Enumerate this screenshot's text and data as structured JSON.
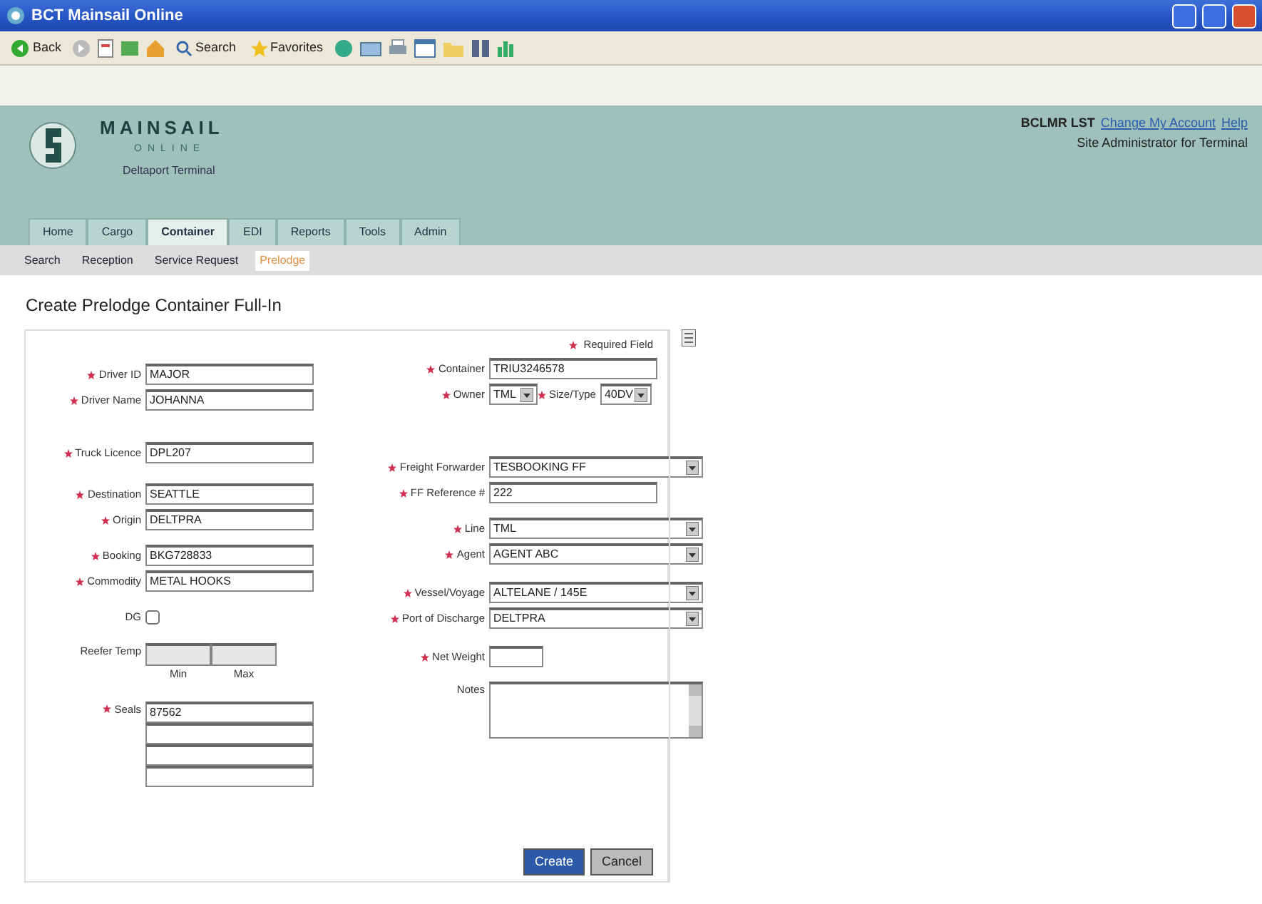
{
  "window": {
    "title": "BCT Mainsail Online"
  },
  "toolbar": {
    "back": "Back",
    "search": "Search",
    "favorites": "Favorites"
  },
  "header": {
    "logo_title": "MAINSAIL",
    "logo_subtitle": "ONLINE",
    "terminal": "Deltaport Terminal",
    "user": "BCLMR LST",
    "links": [
      "Change My Account",
      "Help"
    ],
    "role": "Site Administrator for Terminal"
  },
  "tabs": [
    {
      "label": "Home",
      "selected": false
    },
    {
      "label": "Cargo",
      "selected": false
    },
    {
      "label": "Container",
      "selected": true
    },
    {
      "label": "EDI",
      "selected": false
    },
    {
      "label": "Reports",
      "selected": false
    },
    {
      "label": "Tools",
      "selected": false
    },
    {
      "label": "Admin",
      "selected": false
    }
  ],
  "subtabs": [
    {
      "label": "Search",
      "selected": false
    },
    {
      "label": "Reception",
      "selected": false
    },
    {
      "label": "Service Request",
      "selected": false
    },
    {
      "label": "Prelodge",
      "selected": true
    }
  ],
  "heading": "Create Prelodge Container Full-In",
  "required_note": "Required Field",
  "left_groups": [
    {
      "fields": [
        {
          "kind": "text",
          "label": "Driver ID",
          "required": true,
          "value": "MAJOR"
        },
        {
          "kind": "text",
          "label": "Driver Name",
          "required": true,
          "value": "JOHANNA"
        }
      ]
    },
    {
      "fields": [
        {
          "kind": "text",
          "label": "Truck Licence",
          "required": true,
          "value": "DPL207"
        }
      ]
    },
    {
      "fields": [
        {
          "kind": "text",
          "label": "Destination",
          "required": true,
          "value": "SEATTLE"
        },
        {
          "kind": "text",
          "label": "Origin",
          "required": true,
          "value": "DELTPRA"
        }
      ]
    },
    {
      "fields": [
        {
          "kind": "text",
          "label": "Booking",
          "required": true,
          "value": "BKG728833"
        },
        {
          "kind": "text",
          "label": "Commodity",
          "required": true,
          "value": "METAL HOOKS"
        }
      ]
    },
    {
      "fields": [
        {
          "kind": "checkbox",
          "label": "DG",
          "required": false,
          "checked": false
        }
      ]
    },
    {
      "fields": [
        {
          "kind": "range",
          "label": "Reefer Temp",
          "required": false,
          "sub_labels": [
            "Min",
            "Max"
          ]
        }
      ]
    },
    {
      "fields": [
        {
          "kind": "seals",
          "label": "Seals",
          "required": true,
          "values": [
            "87562"
          ]
        }
      ]
    }
  ],
  "right_groups": [
    {
      "fields": [
        {
          "kind": "text",
          "label": "Container",
          "required": true,
          "value": "TRIU3246578"
        },
        {
          "kind": "pair",
          "items": [
            {
              "label": "Owner",
              "required": true,
              "value": "TML"
            },
            {
              "label": "Size/Type",
              "required": true,
              "value": "40DV"
            }
          ]
        }
      ]
    },
    {
      "fields": [
        {
          "kind": "select",
          "label": "Freight Forwarder",
          "required": true,
          "value": "TESBOOKING FF"
        },
        {
          "kind": "text",
          "label": "FF Reference #",
          "required": true,
          "value": "222"
        }
      ]
    },
    {
      "fields": [
        {
          "kind": "select",
          "label": "Line",
          "required": true,
          "value": "TML"
        },
        {
          "kind": "select",
          "label": "Agent",
          "required": true,
          "value": "AGENT ABC"
        }
      ]
    },
    {
      "fields": [
        {
          "kind": "select",
          "label": "Vessel/Voyage",
          "required": true,
          "value": "ALTELANE / 145E"
        },
        {
          "kind": "select",
          "label": "Port of Discharge",
          "required": true,
          "value": "DELTPRA"
        }
      ]
    },
    {
      "fields": [
        {
          "kind": "short",
          "label": "Net Weight",
          "required": true
        }
      ]
    },
    {
      "fields": [
        {
          "kind": "textarea",
          "label": "Notes",
          "required": false
        }
      ]
    }
  ],
  "buttons": [
    {
      "label": "Create",
      "kind": "primary"
    },
    {
      "label": "Cancel",
      "kind": "secondary"
    }
  ]
}
